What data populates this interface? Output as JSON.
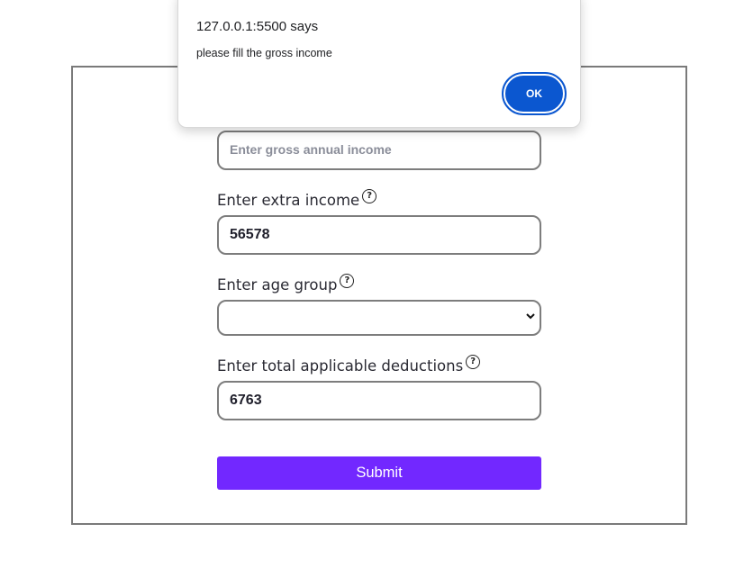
{
  "alert": {
    "title": "127.0.0.1:5500 says",
    "message": "please fill the gross income",
    "ok_label": "OK"
  },
  "form": {
    "gross_income": {
      "placeholder": "Enter gross annual income",
      "value": ""
    },
    "extra_income": {
      "label": "Enter extra income",
      "value": "56578"
    },
    "age_group": {
      "label": "Enter age group",
      "selected": ""
    },
    "deductions": {
      "label": "Enter total applicable deductions",
      "value": "6763"
    },
    "help_glyph": "?",
    "submit_label": "Submit"
  },
  "colors": {
    "submit_bg": "#7228ff",
    "ok_bg": "#0b57d0",
    "frame_border": "#7a7a7a"
  },
  "icons": {
    "help": "question-circle-icon",
    "select_arrow": "chevron-down-icon"
  }
}
